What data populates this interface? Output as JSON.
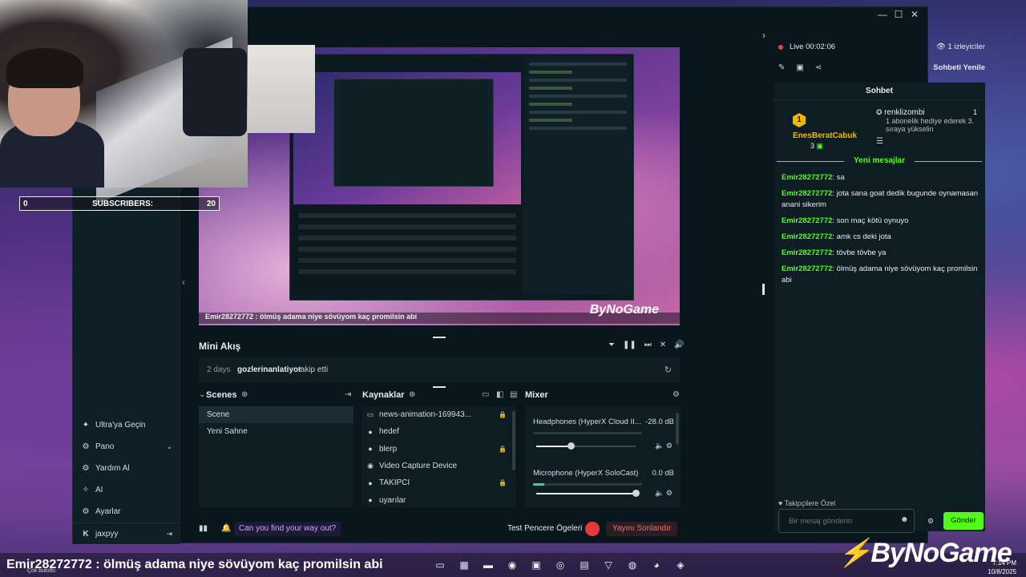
{
  "window": {
    "minimize": "—",
    "maximize": "☐",
    "close": "✕"
  },
  "nav": {
    "items": [
      {
        "icon": "rocket-icon",
        "glyph": "✦",
        "label": "Ultra'ya Geçin"
      },
      {
        "icon": "dashboard-icon",
        "glyph": "⚙",
        "label": "Pano",
        "extra": "⌄"
      },
      {
        "icon": "help-icon",
        "glyph": "⚙",
        "label": "Yardım Al"
      },
      {
        "icon": "ai-icon",
        "glyph": "✧",
        "label": "AI"
      },
      {
        "icon": "settings-icon",
        "glyph": "⚙",
        "label": "Ayarlar"
      }
    ],
    "user": {
      "platform": "K",
      "name": "jaxpyy",
      "logout": "⇥"
    }
  },
  "preview": {
    "ticker": "Emir28272772 : ölmüş adama niye sövüyom kaç promilsin abi",
    "logo": "ByNoGame"
  },
  "mini_feed": {
    "title": "Mini Akış",
    "controls": [
      "⏷",
      "❚❚",
      "⏭",
      "✕",
      "🔊"
    ],
    "event": {
      "time": "2 days",
      "user": "gozlerinanlatiyor",
      "action": "takip etti",
      "refresh": "↻"
    }
  },
  "scenes": {
    "title": "Scenes",
    "add": "⊕",
    "items": [
      "Scene",
      "Yeni Sahne"
    ]
  },
  "sources": {
    "title": "Kaynaklar",
    "add": "⊕",
    "items": [
      {
        "glyph": "▭",
        "label": "news-animation-169943...",
        "lock": "🔒"
      },
      {
        "glyph": "●",
        "label": "hedef",
        "lock": ""
      },
      {
        "glyph": "●",
        "label": "blerp",
        "lock": "🔒"
      },
      {
        "glyph": "◉",
        "label": "Video Capture Device",
        "lock": ""
      },
      {
        "glyph": "●",
        "label": "TAKIPCI",
        "lock": "🔒"
      },
      {
        "glyph": "●",
        "label": "uyarılar",
        "lock": ""
      }
    ]
  },
  "mixer": {
    "title": "Mixer",
    "channels": [
      {
        "name": "Headphones (HyperX Cloud II...",
        "db": "-28.0 dB",
        "meter": 0,
        "level": 0.35
      },
      {
        "name": "Microphone (HyperX SoloCast)",
        "db": "0.0 dB",
        "meter": 0.1,
        "level": 1.0
      }
    ]
  },
  "footer": {
    "help": "Can you find your way out?",
    "test_windows": "Test Pencere Ögeleri",
    "end_stream": "Yayını Sonlandır"
  },
  "right_panel": {
    "live": "Live 00:02:06",
    "viewers": "1 izleyiciler",
    "refresh": "Sohbeti Yenile",
    "tools": [
      "✎",
      "▣",
      "⋖"
    ],
    "chat_title": "Sohbet",
    "top_gifter": {
      "rank": "1",
      "name": "EnesBeratCabuk",
      "count": "3"
    },
    "second_gifter": {
      "name": "renklizombi",
      "count": "1",
      "detail": "1 abonelik hediye ederek 3. sıraya yükselin"
    },
    "new_messages": "Yeni mesajlar",
    "messages": [
      {
        "user": "Emir28272772",
        "text": ": sa"
      },
      {
        "user": "Emir28272772",
        "text": ": jota sana goat dedik bugunde oynamasan anani sikerim"
      },
      {
        "user": "Emir28272772",
        "text": ": son maç kötü oynuyo"
      },
      {
        "user": "Emir28272772",
        "text": ": amk cs deki jota"
      },
      {
        "user": "Emir28272772",
        "text": ": tövbe tövbe ya"
      },
      {
        "user": "Emir28272772",
        "text": ": ölmüş adama niye sövüyom kaç promilsin abi"
      }
    ],
    "favorites": "♥ Takipçilere Özel",
    "input_placeholder": "Bir mesaj gönderin",
    "send": "Gönder"
  },
  "overlay": {
    "subs_left": "0",
    "subs_label": "SUBSCRIBERS:",
    "subs_right": "20"
  },
  "taskbar": {
    "ticker": "Emir28272772 : ölmüş adama niye sövüyom kaç promilsin abi",
    "weather": "Çok bulutlu",
    "logo": "ByNoGame",
    "time": "7:14 PM",
    "date": "10/8/2025"
  },
  "colors": {
    "accent": "#53fc18",
    "live": "#ff3b3b",
    "gold": "#f2b705",
    "bg": "#09161d"
  }
}
